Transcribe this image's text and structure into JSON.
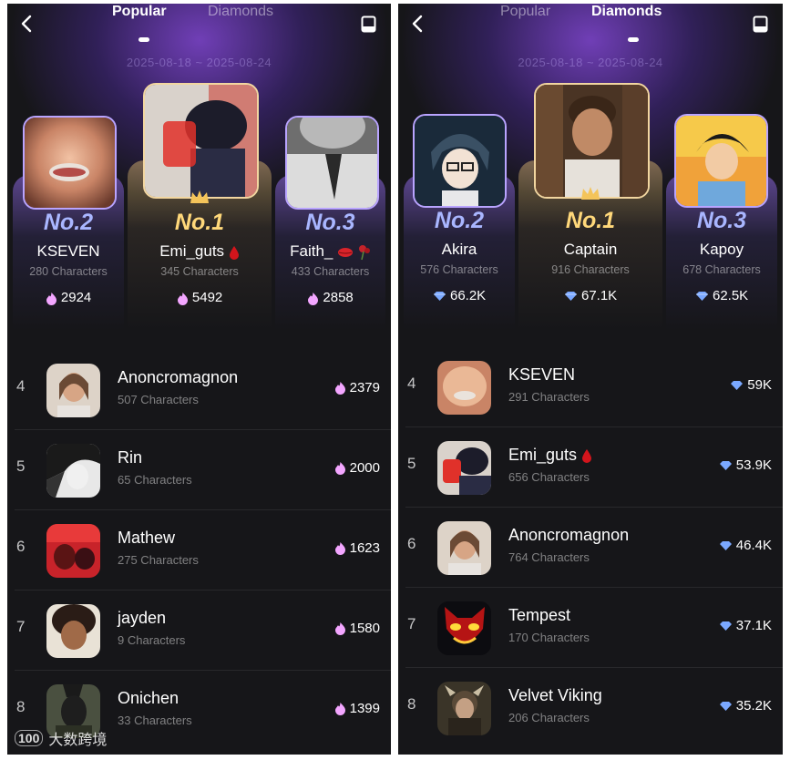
{
  "colors": {
    "background": "#161619",
    "accent_purple": "#8a5cf0",
    "gold": "#ffd87a",
    "rank_blue": "#a9b6ff",
    "flame": "#f3a6ff",
    "diamond": "#7aa8ff"
  },
  "left": {
    "tabs": {
      "popular": "Popular",
      "diamonds": "Diamonds",
      "active": "popular"
    },
    "date_range": "2025-08-18 ~ 2025-08-24",
    "podium": [
      {
        "rank": "No.2",
        "name": "KSEVEN",
        "characters": "280 Characters",
        "score": "2924",
        "score_icon": "flame-icon"
      },
      {
        "rank": "No.1",
        "name": "Emi_guts",
        "characters": "345 Characters",
        "score": "5492",
        "score_icon": "flame-icon",
        "badge": "blood-drop-icon"
      },
      {
        "rank": "No.3",
        "name": "Faith_",
        "characters": "433 Characters",
        "score": "2858",
        "score_icon": "flame-icon",
        "badge": "lips-rose-icon"
      }
    ],
    "list": [
      {
        "rank": "4",
        "name": "Anoncromagnon",
        "characters": "507 Characters",
        "score": "2379"
      },
      {
        "rank": "5",
        "name": "Rin",
        "characters": "65 Characters",
        "score": "2000"
      },
      {
        "rank": "6",
        "name": "Mathew",
        "characters": "275 Characters",
        "score": "1623"
      },
      {
        "rank": "7",
        "name": "jayden",
        "characters": "9 Characters",
        "score": "1580"
      },
      {
        "rank": "8",
        "name": "Onichen",
        "characters": "33 Characters",
        "score": "1399"
      }
    ],
    "watermark": "大数跨境"
  },
  "right": {
    "tabs": {
      "popular": "Popular",
      "diamonds": "Diamonds",
      "active": "diamonds"
    },
    "date_range": "2025-08-18 ~ 2025-08-24",
    "podium": [
      {
        "rank": "No.2",
        "name": "Akira",
        "characters": "576 Characters",
        "score": "66.2K",
        "score_icon": "diamond-icon"
      },
      {
        "rank": "No.1",
        "name": "Captain",
        "characters": "916 Characters",
        "score": "67.1K",
        "score_icon": "diamond-icon"
      },
      {
        "rank": "No.3",
        "name": "Kapoy",
        "characters": "678 Characters",
        "score": "62.5K",
        "score_icon": "diamond-icon"
      }
    ],
    "list": [
      {
        "rank": "4",
        "name": "KSEVEN",
        "characters": "291 Characters",
        "score": "59K"
      },
      {
        "rank": "5",
        "name": "Emi_guts",
        "characters": "656 Characters",
        "score": "53.9K"
      },
      {
        "rank": "6",
        "name": "Anoncromagnon",
        "characters": "764 Characters",
        "score": "46.4K"
      },
      {
        "rank": "7",
        "name": "Tempest",
        "characters": "170 Characters",
        "score": "37.1K"
      },
      {
        "rank": "8",
        "name": "Velvet Viking",
        "characters": "206 Characters",
        "score": "35.2K"
      }
    ]
  }
}
